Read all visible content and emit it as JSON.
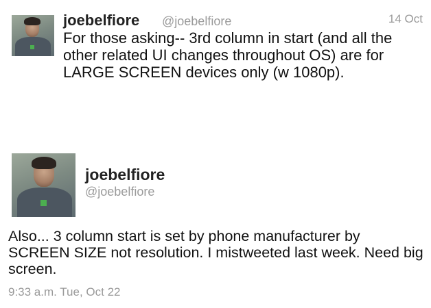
{
  "tweets": [
    {
      "name": "joebelfiore",
      "handle": "@joebelfiore",
      "date": "14 Oct",
      "text": "For those asking-- 3rd column in start (and all the other related UI changes throughout OS) are for LARGE SCREEN devices only (w 1080p)."
    },
    {
      "name": "joebelfiore",
      "handle": "@joebelfiore",
      "text": "Also... 3 column start is set by phone manufacturer by SCREEN SIZE not resolution. I mistweeted last week. Need big screen.",
      "timestamp": "9:33 a.m. Tue, Oct 22"
    }
  ]
}
